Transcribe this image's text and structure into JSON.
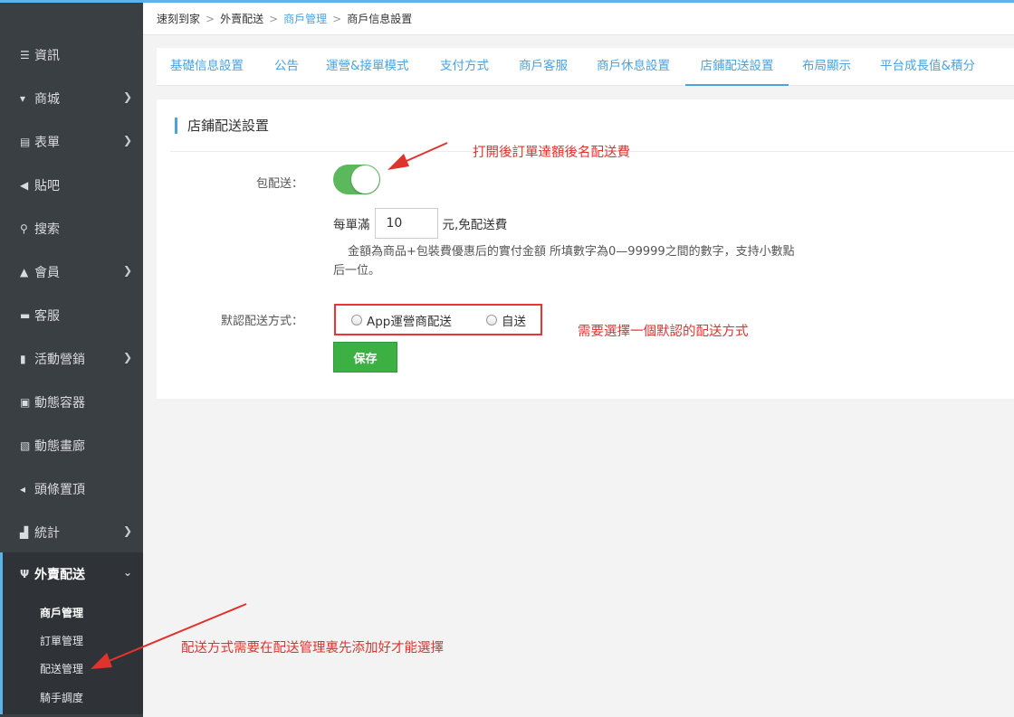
{
  "colors": {
    "accent": "#4aa3df",
    "sidebar_bg": "#3a3f44",
    "toggle_on": "#5cb85c",
    "save": "#3cb043",
    "annotation": "#e0332e"
  },
  "breadcrumb": [
    "速刻到家",
    "外賣配送",
    "商戶管理",
    "商戶信息設置"
  ],
  "sidebar": {
    "items": [
      {
        "label": "資訊",
        "icon": "list-icon"
      },
      {
        "label": "商城",
        "icon": "cart-icon"
      },
      {
        "label": "表單",
        "icon": "form-icon"
      },
      {
        "label": "貼吧",
        "icon": "megaphone-icon"
      },
      {
        "label": "搜索",
        "icon": "search-icon"
      },
      {
        "label": "會員",
        "icon": "bell-icon"
      },
      {
        "label": "客服",
        "icon": "chat-icon"
      },
      {
        "label": "活動營銷",
        "icon": "bookmark-icon"
      },
      {
        "label": "動態容器",
        "icon": "inbox-icon"
      },
      {
        "label": "動態畫廊",
        "icon": "image-icon"
      },
      {
        "label": "頭條置頂",
        "icon": "volume-icon"
      },
      {
        "label": "統計",
        "icon": "bar-chart-icon"
      },
      {
        "label": "外賣配送",
        "icon": "cutlery-icon"
      }
    ],
    "sub_items": [
      "商戶管理",
      "訂單管理",
      "配送管理",
      "騎手調度"
    ]
  },
  "tabs": [
    "基礎信息設置",
    "公告",
    "運營&接單模式",
    "支付方式",
    "商戶客服",
    "商戶休息設置",
    "店鋪配送設置",
    "布局顯示",
    "平台成長值&積分"
  ],
  "panel": {
    "title": "店鋪配送設置",
    "free_label": "包配送：",
    "toggle_on": true,
    "each_order_prefix": "每單滿",
    "threshold": "10",
    "unit_suffix": "元,免配送費",
    "help": "金額為商品+包裝費優惠后的實付金額 所填數字為0—99999之間的數字，支持小數點后一位。",
    "default_method_label": "默認配送方式：",
    "options": [
      "App運營商配送",
      "自送"
    ],
    "save": "保存"
  },
  "annotations": {
    "toggle_note": "打開後訂單達額後名配送費",
    "radio_note": "需要選擇一個默認的配送方式",
    "delivery_note": "配送方式需要在配送管理裏先添加好才能選擇"
  }
}
